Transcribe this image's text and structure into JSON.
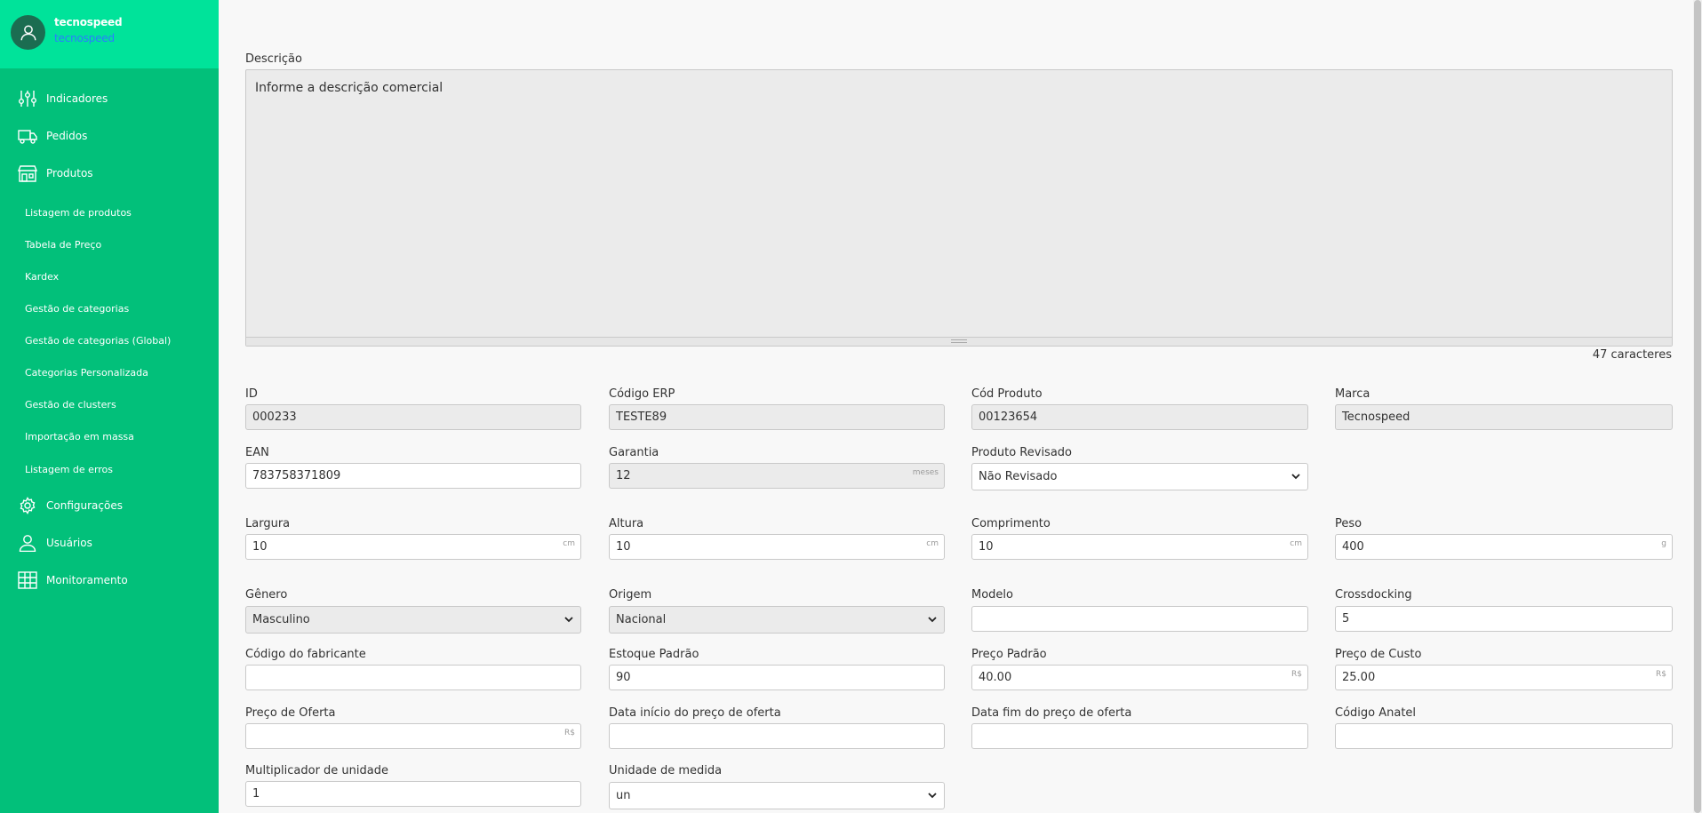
{
  "user": {
    "name": "tecnospeed",
    "company": "tecnospeed"
  },
  "nav": {
    "indicadores": "Indicadores",
    "pedidos": "Pedidos",
    "produtos": "Produtos",
    "configuracoes": "Configurações",
    "usuarios": "Usuários",
    "monitoramento": "Monitoramento"
  },
  "subnav": [
    "Listagem de produtos",
    "Tabela de Preço",
    "Kardex",
    "Gestão de categorias",
    "Gestão de categorias (Global)",
    "Categorias Personalizada",
    "Gestão de clusters",
    "Importação em massa",
    "Listagem de erros"
  ],
  "description": {
    "label": "Descrição",
    "placeholder": "Informe a descrição comercial",
    "char_count": "47 caracteres"
  },
  "fields": {
    "id": {
      "label": "ID",
      "value": "000233"
    },
    "codigo_erp": {
      "label": "Código ERP",
      "value": "TESTE89"
    },
    "cod_produto": {
      "label": "Cód Produto",
      "value": "00123654"
    },
    "marca": {
      "label": "Marca",
      "value": "Tecnospeed"
    },
    "ean": {
      "label": "EAN",
      "value": "783758371809"
    },
    "garantia": {
      "label": "Garantia",
      "value": "12",
      "unit": "meses"
    },
    "produto_revisado": {
      "label": "Produto Revisado",
      "value": "Não Revisado"
    },
    "largura": {
      "label": "Largura",
      "value": "10",
      "unit": "cm"
    },
    "altura": {
      "label": "Altura",
      "value": "10",
      "unit": "cm"
    },
    "comprimento": {
      "label": "Comprimento",
      "value": "10",
      "unit": "cm"
    },
    "peso": {
      "label": "Peso",
      "value": "400",
      "unit": "g"
    },
    "genero": {
      "label": "Gênero",
      "value": "Masculino"
    },
    "origem": {
      "label": "Origem",
      "value": "Nacional"
    },
    "modelo": {
      "label": "Modelo",
      "value": ""
    },
    "crossdocking": {
      "label": "Crossdocking",
      "value": "5"
    },
    "codigo_fabricante": {
      "label": "Código do fabricante",
      "value": ""
    },
    "estoque_padrao": {
      "label": "Estoque Padrão",
      "value": "90"
    },
    "preco_padrao": {
      "label": "Preço Padrão",
      "value": "40.00",
      "unit": "R$"
    },
    "preco_custo": {
      "label": "Preço de Custo",
      "value": "25.00",
      "unit": "R$"
    },
    "preco_oferta": {
      "label": "Preço de Oferta",
      "value": "",
      "unit": "R$"
    },
    "data_inicio_oferta": {
      "label": "Data início do preço de oferta",
      "value": ""
    },
    "data_fim_oferta": {
      "label": "Data fim do preço de oferta",
      "value": ""
    },
    "codigo_anatel": {
      "label": "Código Anatel",
      "value": ""
    },
    "multiplicador": {
      "label": "Multiplicador de unidade",
      "value": "1"
    },
    "unidade_medida": {
      "label": "Unidade de medida",
      "value": "un"
    }
  },
  "icons": {
    "avatar": "user-icon",
    "indicadores": "sliders-icon",
    "pedidos": "truck-icon",
    "produtos": "store-icon",
    "configuracoes": "gear-icon",
    "usuarios": "user-icon",
    "monitoramento": "monitor-grid-icon"
  },
  "colors": {
    "sidebar": "#02c07a",
    "sidebar_header": "#00e39a",
    "company": "#2b7cff"
  }
}
